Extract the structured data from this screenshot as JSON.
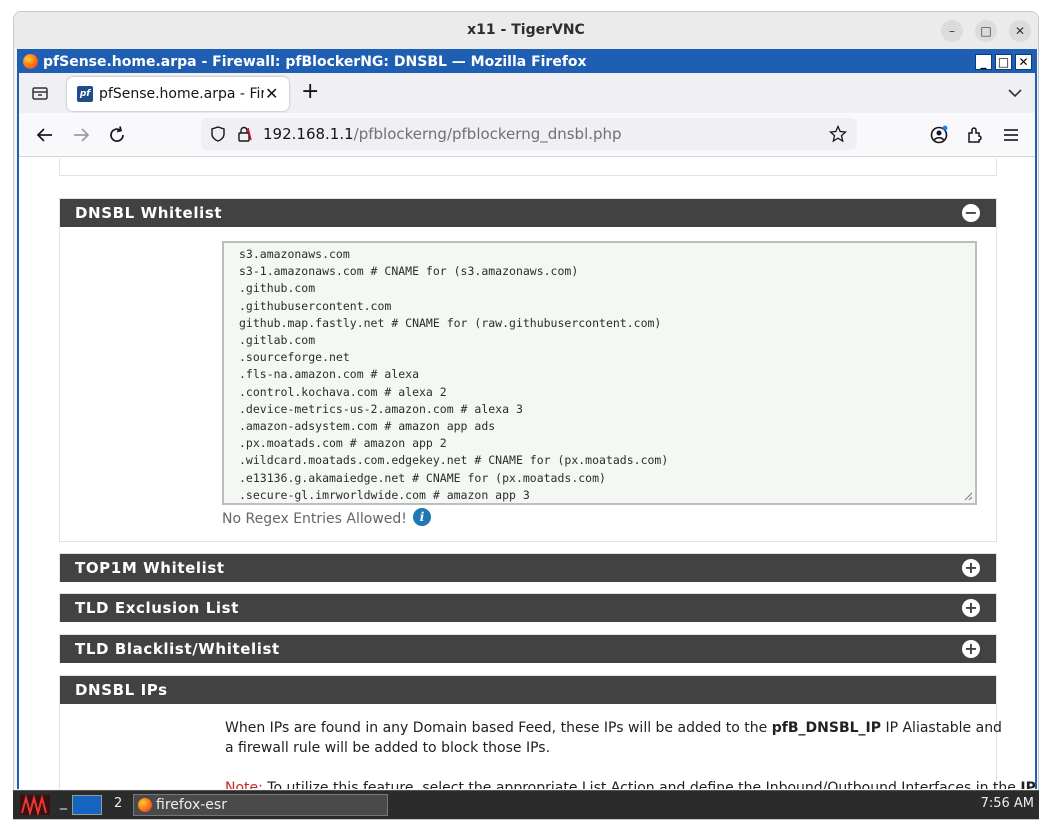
{
  "vnc": {
    "title": "x11 - TigerVNC"
  },
  "firefox": {
    "window_title": "pfSense.home.arpa - Firewall: pfBlockerNG: DNSBL — Mozilla Firefox",
    "tab_label": "pfSense.home.arpa - Fire",
    "tab_favicon": "pf",
    "url_host": "192.168.1.1",
    "url_path": "/pfblockerng/pfblockerng_dnsbl.php"
  },
  "panels": {
    "whitelist": {
      "title": "DNSBL Whitelist",
      "state": "expanded",
      "entries": [
        "s3.amazonaws.com",
        "s3-1.amazonaws.com # CNAME for (s3.amazonaws.com)",
        ".github.com",
        ".githubusercontent.com",
        "github.map.fastly.net # CNAME for (raw.githubusercontent.com)",
        ".gitlab.com",
        ".sourceforge.net",
        ".fls-na.amazon.com # alexa",
        ".control.kochava.com # alexa 2",
        ".device-metrics-us-2.amazon.com # alexa 3",
        ".amazon-adsystem.com # amazon app ads",
        ".px.moatads.com # amazon app 2",
        ".wildcard.moatads.com.edgekey.net # CNAME for (px.moatads.com)",
        ".e13136.g.akamaiedge.net # CNAME for (px.moatads.com)",
        ".secure-gl.imrworldwide.com # amazon app 3"
      ],
      "help": "No Regex Entries Allowed!"
    },
    "top1m": {
      "title": "TOP1M Whitelist",
      "state": "collapsed"
    },
    "tld_exclusion": {
      "title": "TLD Exclusion List",
      "state": "collapsed"
    },
    "tld_blacklist": {
      "title": "TLD Blacklist/Whitelist",
      "state": "collapsed"
    },
    "dnsbl_ips": {
      "title": "DNSBL IPs",
      "line1_a": "When IPs are found in any Domain based Feed, these IPs will be added to the ",
      "line1_b": "pfB_DNSBL_IP",
      "line1_c": " IP Aliastable and",
      "line2": "a firewall rule will be added to block those IPs.",
      "note_label": "Note:",
      "note_a": " To utilize this feature, select the appropriate List Action and define the Inbound/Outbound Interfaces in the ",
      "note_b": "IP Tab",
      "note_c": "."
    }
  },
  "taskbar": {
    "workspace": "2",
    "app_label": "firefox-esr",
    "clock": "7:56 AM"
  },
  "colors": {
    "panel_heading": "#424242",
    "x11_title": "#1e5fb3",
    "note": "#c62828",
    "textarea_bg": "#f4f8f2"
  }
}
